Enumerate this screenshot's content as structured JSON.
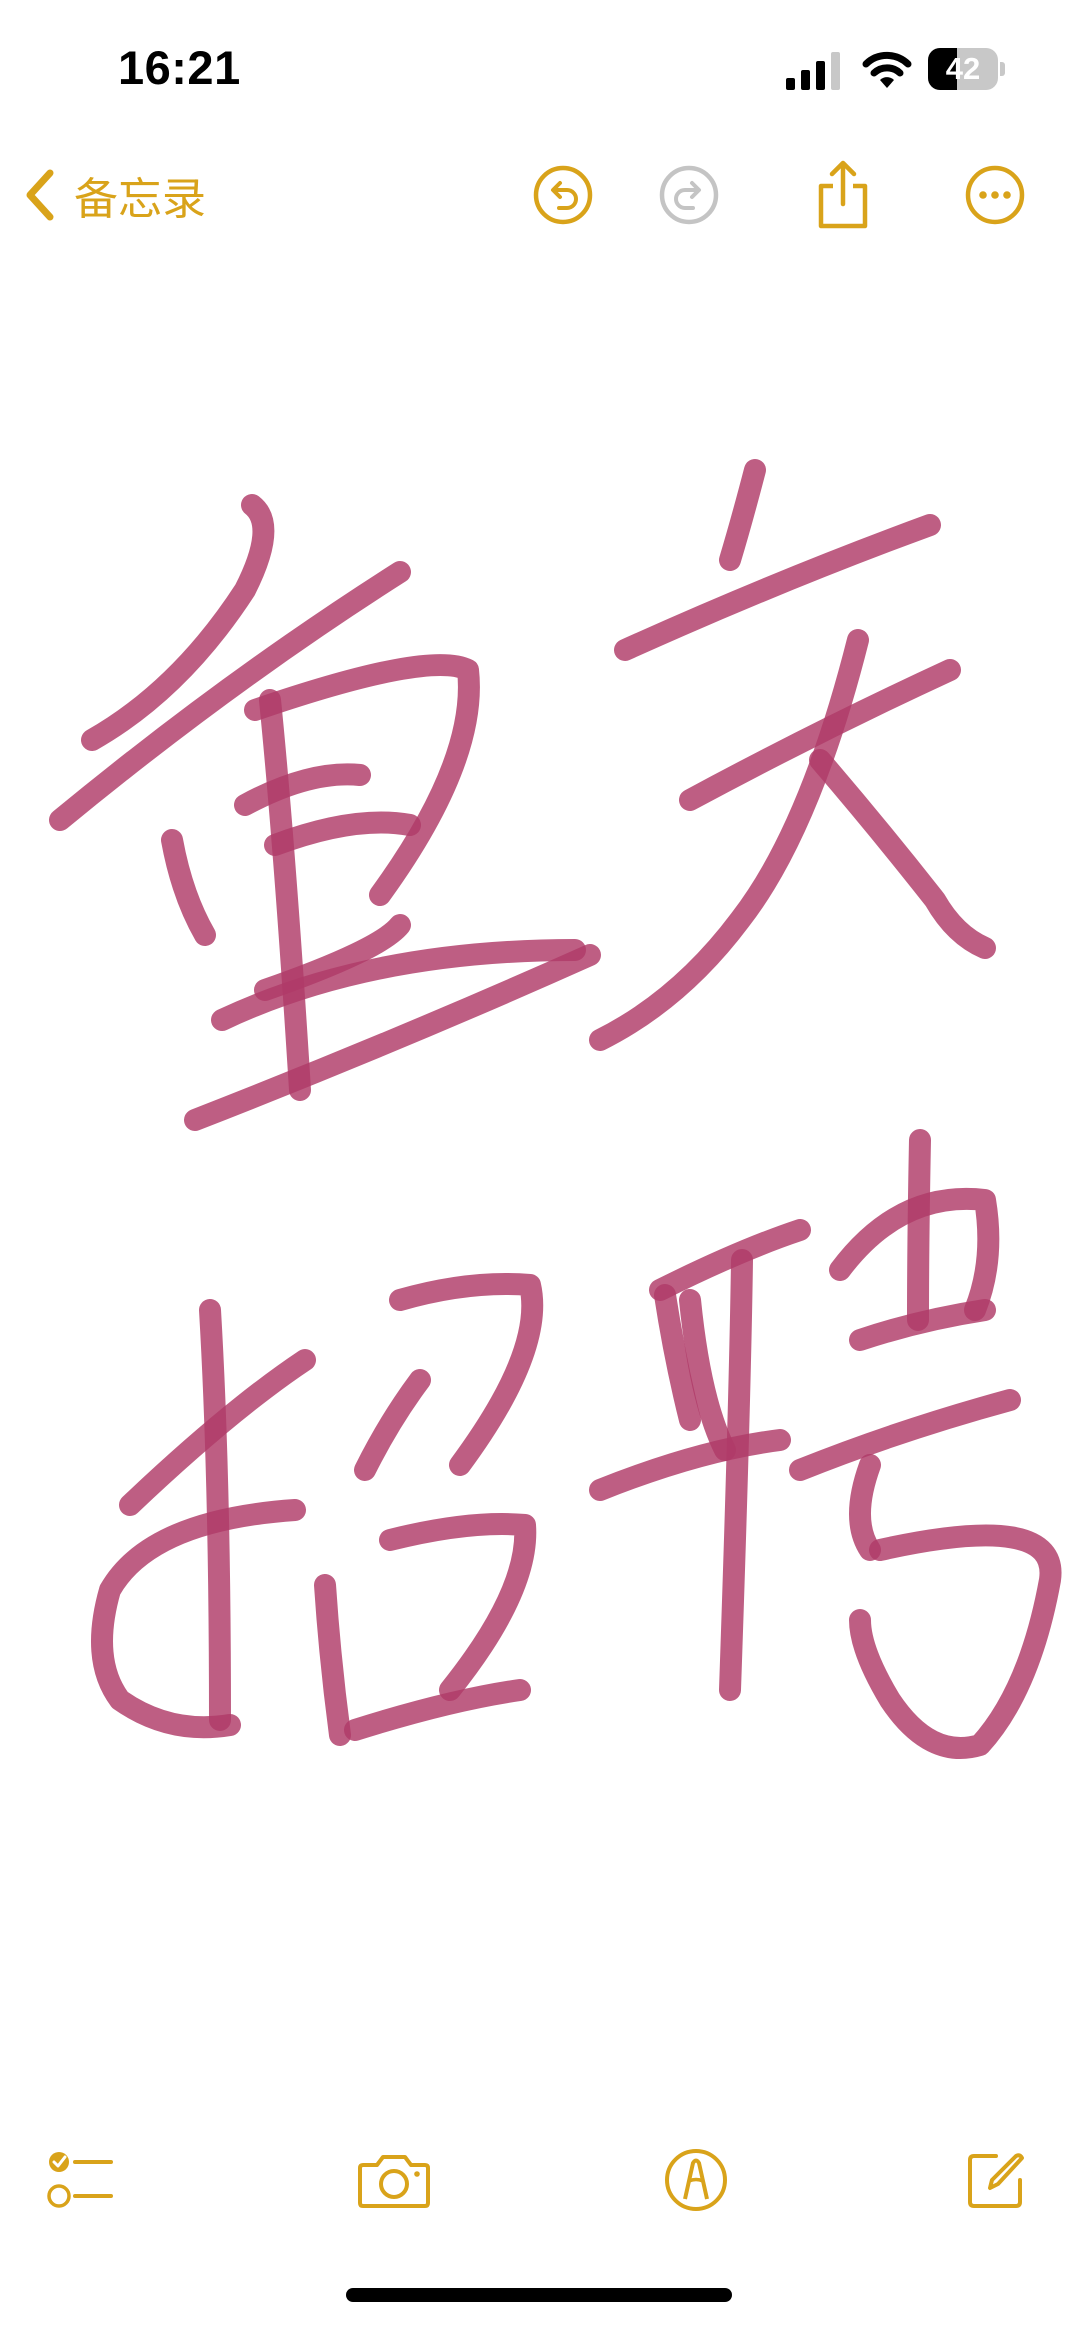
{
  "status_bar": {
    "time": "16:21",
    "battery_level": "42",
    "battery_fraction": 0.42
  },
  "nav": {
    "back_label": "备忘录",
    "back_icon": "chevron-left-icon",
    "undo_icon": "undo-icon",
    "redo_icon": "redo-icon",
    "share_icon": "share-icon",
    "more_icon": "ellipsis-icon",
    "redo_enabled": false
  },
  "canvas": {
    "ink_color": "#b03a68",
    "content": "handwritten-chinese-characters"
  },
  "toolbar": {
    "checklist_icon": "checklist-icon",
    "camera_icon": "camera-icon",
    "markup_icon": "markup-pen-icon",
    "compose_icon": "compose-icon"
  },
  "colors": {
    "accent": "#d9a31a",
    "disabled": "#c4c4c4",
    "background": "#ffffff",
    "ink": "#b03a68"
  }
}
